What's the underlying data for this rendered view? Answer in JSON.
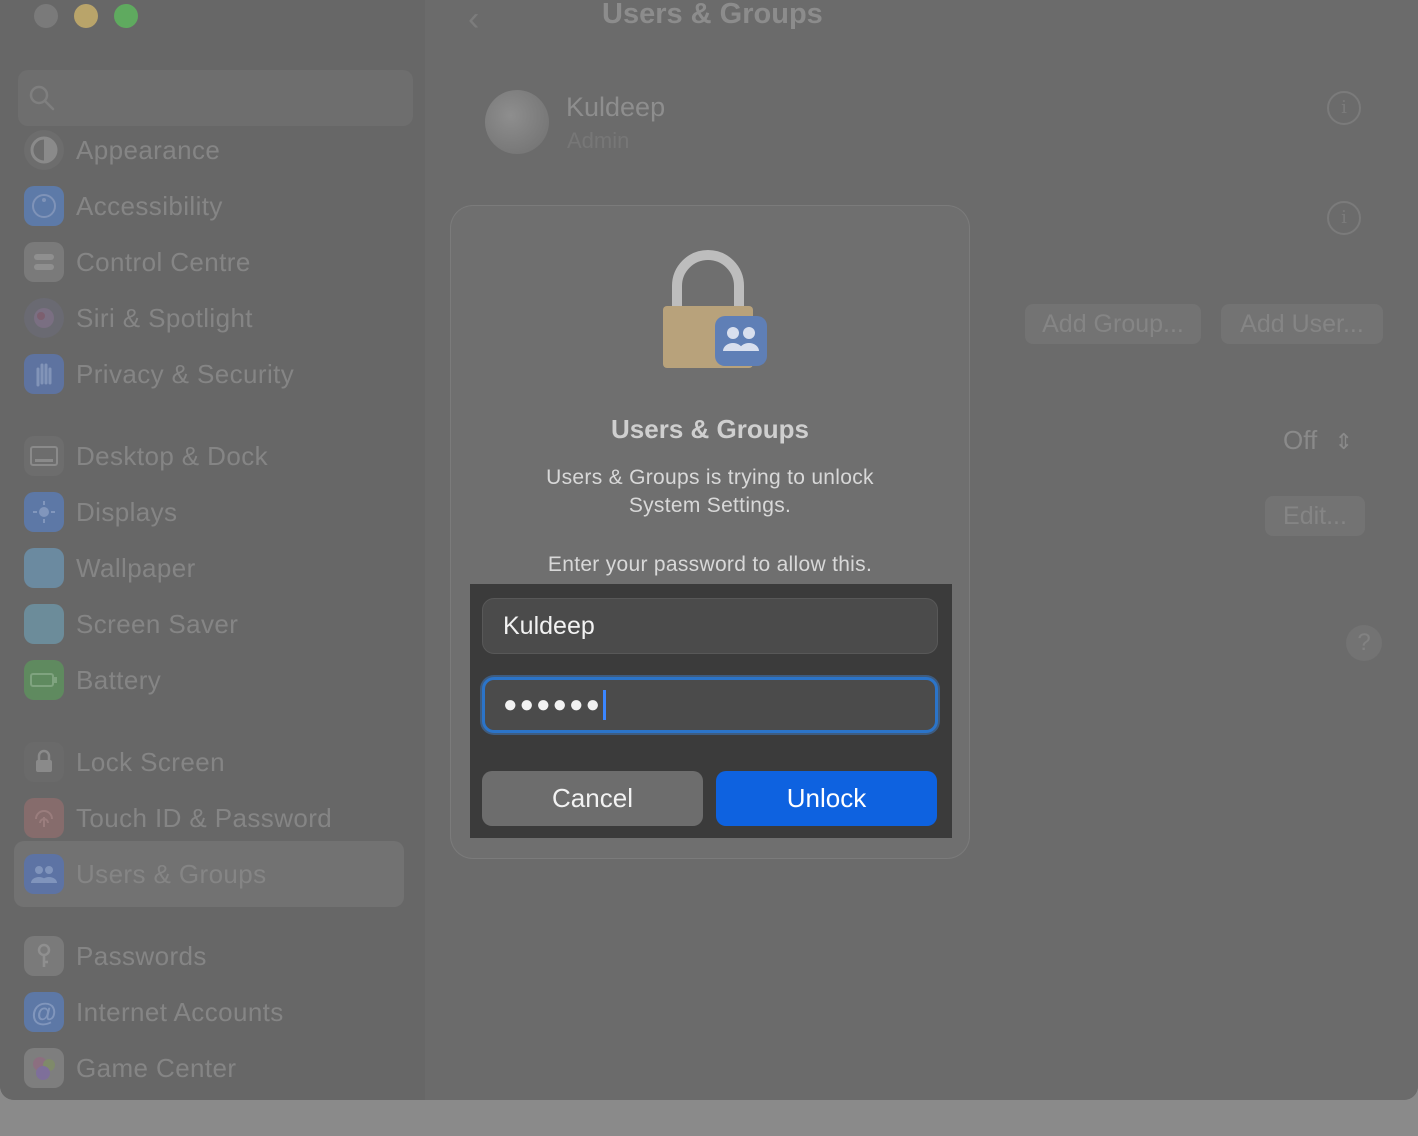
{
  "window": {
    "title": "Users & Groups",
    "traffic_lights": [
      "close",
      "minimize",
      "maximize"
    ]
  },
  "sidebar": {
    "items": [
      {
        "label": "Appearance",
        "icon": "appearance-icon",
        "color": "#7c7c7c"
      },
      {
        "label": "Accessibility",
        "icon": "accessibility-icon",
        "color": "#5d7aa8"
      },
      {
        "label": "Control Centre",
        "icon": "control-centre-icon",
        "color": "#7a7a7a"
      },
      {
        "label": "Siri & Spotlight",
        "icon": "siri-icon",
        "color": "#6b6b7a"
      },
      {
        "label": "Privacy & Security",
        "icon": "hand-icon",
        "color": "#5e73a0"
      },
      {
        "label": "Desktop & Dock",
        "icon": "dock-icon",
        "color": "#6d6d6d"
      },
      {
        "label": "Displays",
        "icon": "displays-icon",
        "color": "#5d78a6"
      },
      {
        "label": "Wallpaper",
        "icon": "wallpaper-icon",
        "color": "#6b8aa0"
      },
      {
        "label": "Screen Saver",
        "icon": "screen-saver-icon",
        "color": "#6c8c9a"
      },
      {
        "label": "Battery",
        "icon": "battery-icon",
        "color": "#5f8a5f"
      },
      {
        "label": "Lock Screen",
        "icon": "lock-screen-icon",
        "color": "#6a6a6a"
      },
      {
        "label": "Touch ID & Password",
        "icon": "fingerprint-icon",
        "color": "#8a6a6a"
      },
      {
        "label": "Users & Groups",
        "icon": "users-icon",
        "color": "#5d73a4"
      },
      {
        "label": "Passwords",
        "icon": "key-icon",
        "color": "#7a7a7a"
      },
      {
        "label": "Internet Accounts",
        "icon": "at-icon",
        "color": "#5d78a6"
      },
      {
        "label": "Game Center",
        "icon": "game-center-icon",
        "color": "#8a6e7e"
      }
    ]
  },
  "content": {
    "user": {
      "name": "Kuldeep",
      "role": "Admin"
    },
    "buttons": {
      "add_group": "Add Group...",
      "add_user": "Add User..."
    },
    "off_select": "Off",
    "edit_button": "Edit...",
    "help": "?"
  },
  "dialog": {
    "title": "Users & Groups",
    "message_line1": "Users & Groups is trying to unlock",
    "message_line2": "System Settings.",
    "prompt": "Enter your password to allow this.",
    "username_value": "Kuldeep",
    "password_mask": "●●●●●●",
    "cancel_label": "Cancel",
    "unlock_label": "Unlock",
    "accent": "#0e62e0"
  }
}
